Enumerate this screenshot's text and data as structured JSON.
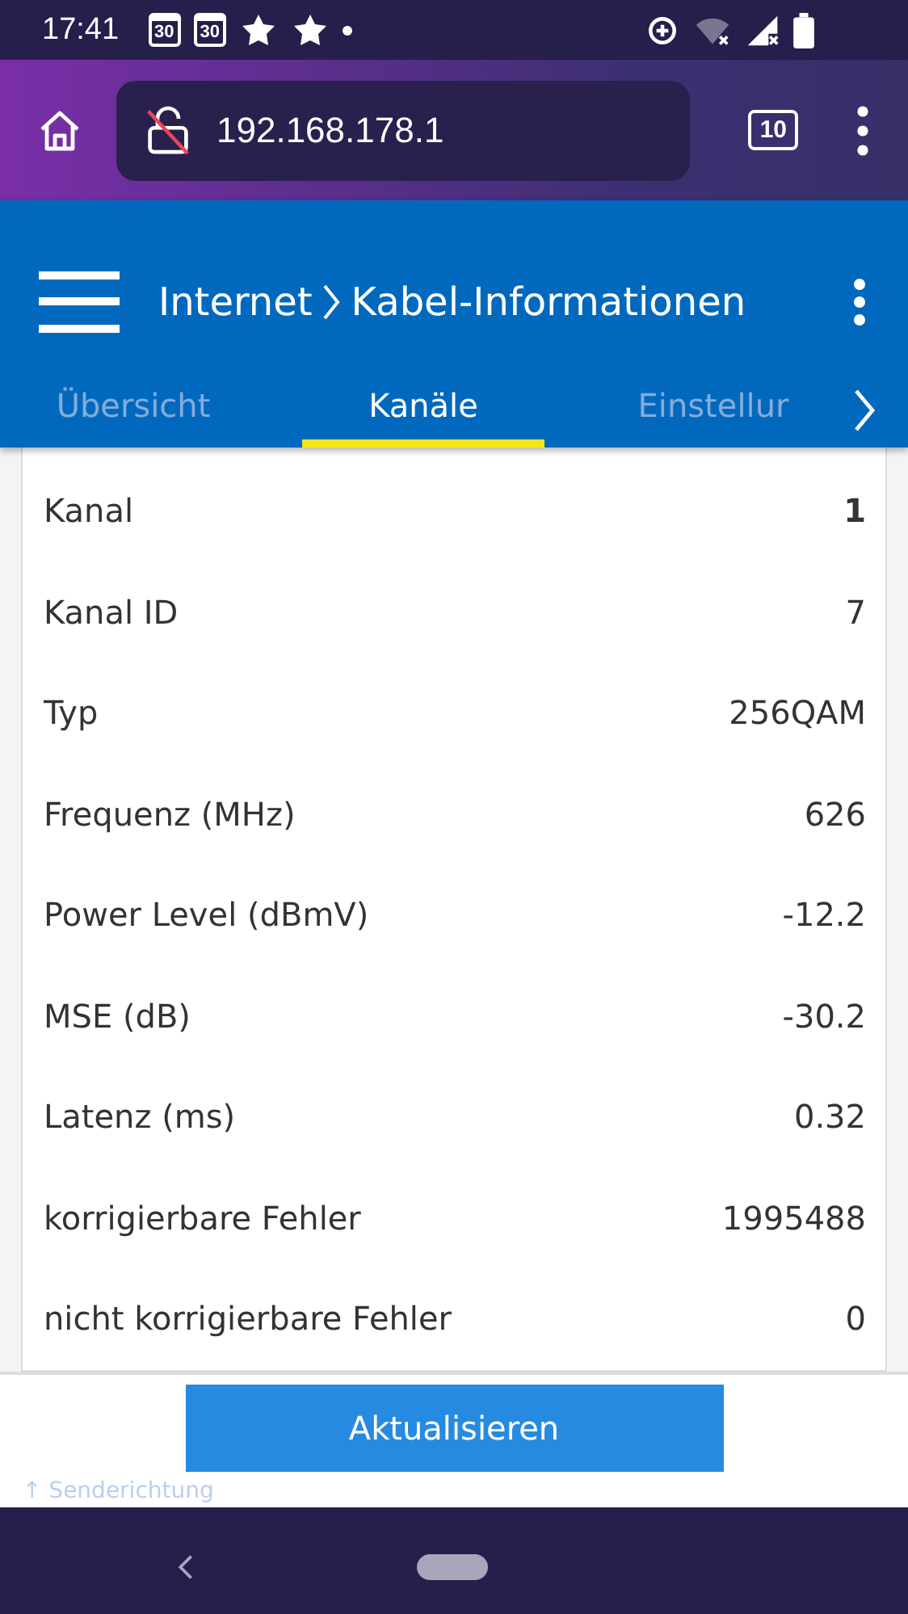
{
  "status_bar": {
    "time": "17:41",
    "calendar_icons": [
      "30",
      "30"
    ]
  },
  "browser": {
    "url": "192.168.178.1",
    "tab_count": "10"
  },
  "header": {
    "breadcrumb": [
      "Internet",
      "Kabel-Informationen"
    ]
  },
  "tabs": [
    {
      "label": "Übersicht",
      "selected": false
    },
    {
      "label": "Kanäle",
      "selected": true
    },
    {
      "label": "Einstellur",
      "selected": false
    }
  ],
  "rows": [
    {
      "label": "Kanal",
      "value": "1",
      "emphasized": true
    },
    {
      "label": "Kanal ID",
      "value": "7",
      "emphasized": false
    },
    {
      "label": "Typ",
      "value": "256QAM",
      "emphasized": false
    },
    {
      "label": "Frequenz (MHz)",
      "value": "626",
      "emphasized": false
    },
    {
      "label": "Power Level (dBmV)",
      "value": "-12.2",
      "emphasized": false
    },
    {
      "label": "MSE (dB)",
      "value": "-30.2",
      "emphasized": false
    },
    {
      "label": "Latenz (ms)",
      "value": "0.32",
      "emphasized": false
    },
    {
      "label": "korrigierbare Fehler",
      "value": "1995488",
      "emphasized": false
    },
    {
      "label": "nicht korrigierbare Fehler",
      "value": "0",
      "emphasized": false
    }
  ],
  "refresh_button": "Aktualisieren",
  "section_link": "↑ Senderichtung"
}
